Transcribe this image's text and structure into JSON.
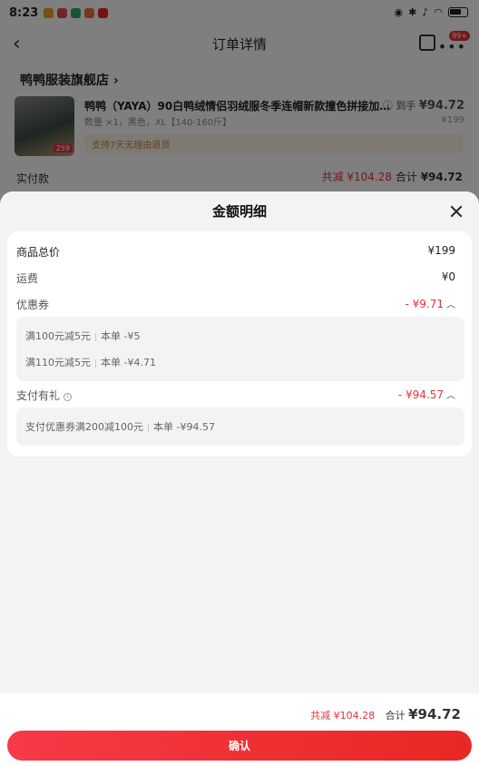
{
  "status_bar": {
    "time": "8:23"
  },
  "nav": {
    "title": "订单详情",
    "badge": "99+"
  },
  "store": {
    "name": "鸭鸭服装旗舰店",
    "item_title": "鸭鸭（YAYA）90白鸭绒情侣羽绒服冬季连帽新款撞色拼接加厚…",
    "item_spec": "数量 ×1，黑色，XL【140-160斤】",
    "price_prefix": "到手",
    "price": "¥94.72",
    "orig_price": "¥199",
    "thumb_tag": "259",
    "return_note": "支持7天无理由退货"
  },
  "paid": {
    "label": "实付款",
    "discount": "共减 ¥104.28",
    "total_label": "合计",
    "total": "¥94.72"
  },
  "sheet": {
    "title": "金额明细",
    "rows": {
      "goods_label": "商品总价",
      "goods_value": "¥199",
      "ship_label": "运费",
      "ship_value": "¥0",
      "coupon_label": "优惠券",
      "coupon_value": "- ¥9.71",
      "coupon_lines": [
        {
          "text": "满100元减5元",
          "scope": "本单",
          "amount": "-¥5"
        },
        {
          "text": "满110元减5元",
          "scope": "本单",
          "amount": "-¥4.71"
        }
      ],
      "gift_label": "支付有礼",
      "gift_value": "- ¥94.57",
      "gift_lines": [
        {
          "text": "支付优惠券满200减100元",
          "scope": "本单",
          "amount": "-¥94.57"
        }
      ]
    }
  },
  "footer": {
    "discount": "共减 ¥104.28",
    "total_label": "合计",
    "total": "¥94.72",
    "confirm": "确认"
  },
  "colors": {
    "accent": "#e8323c"
  }
}
